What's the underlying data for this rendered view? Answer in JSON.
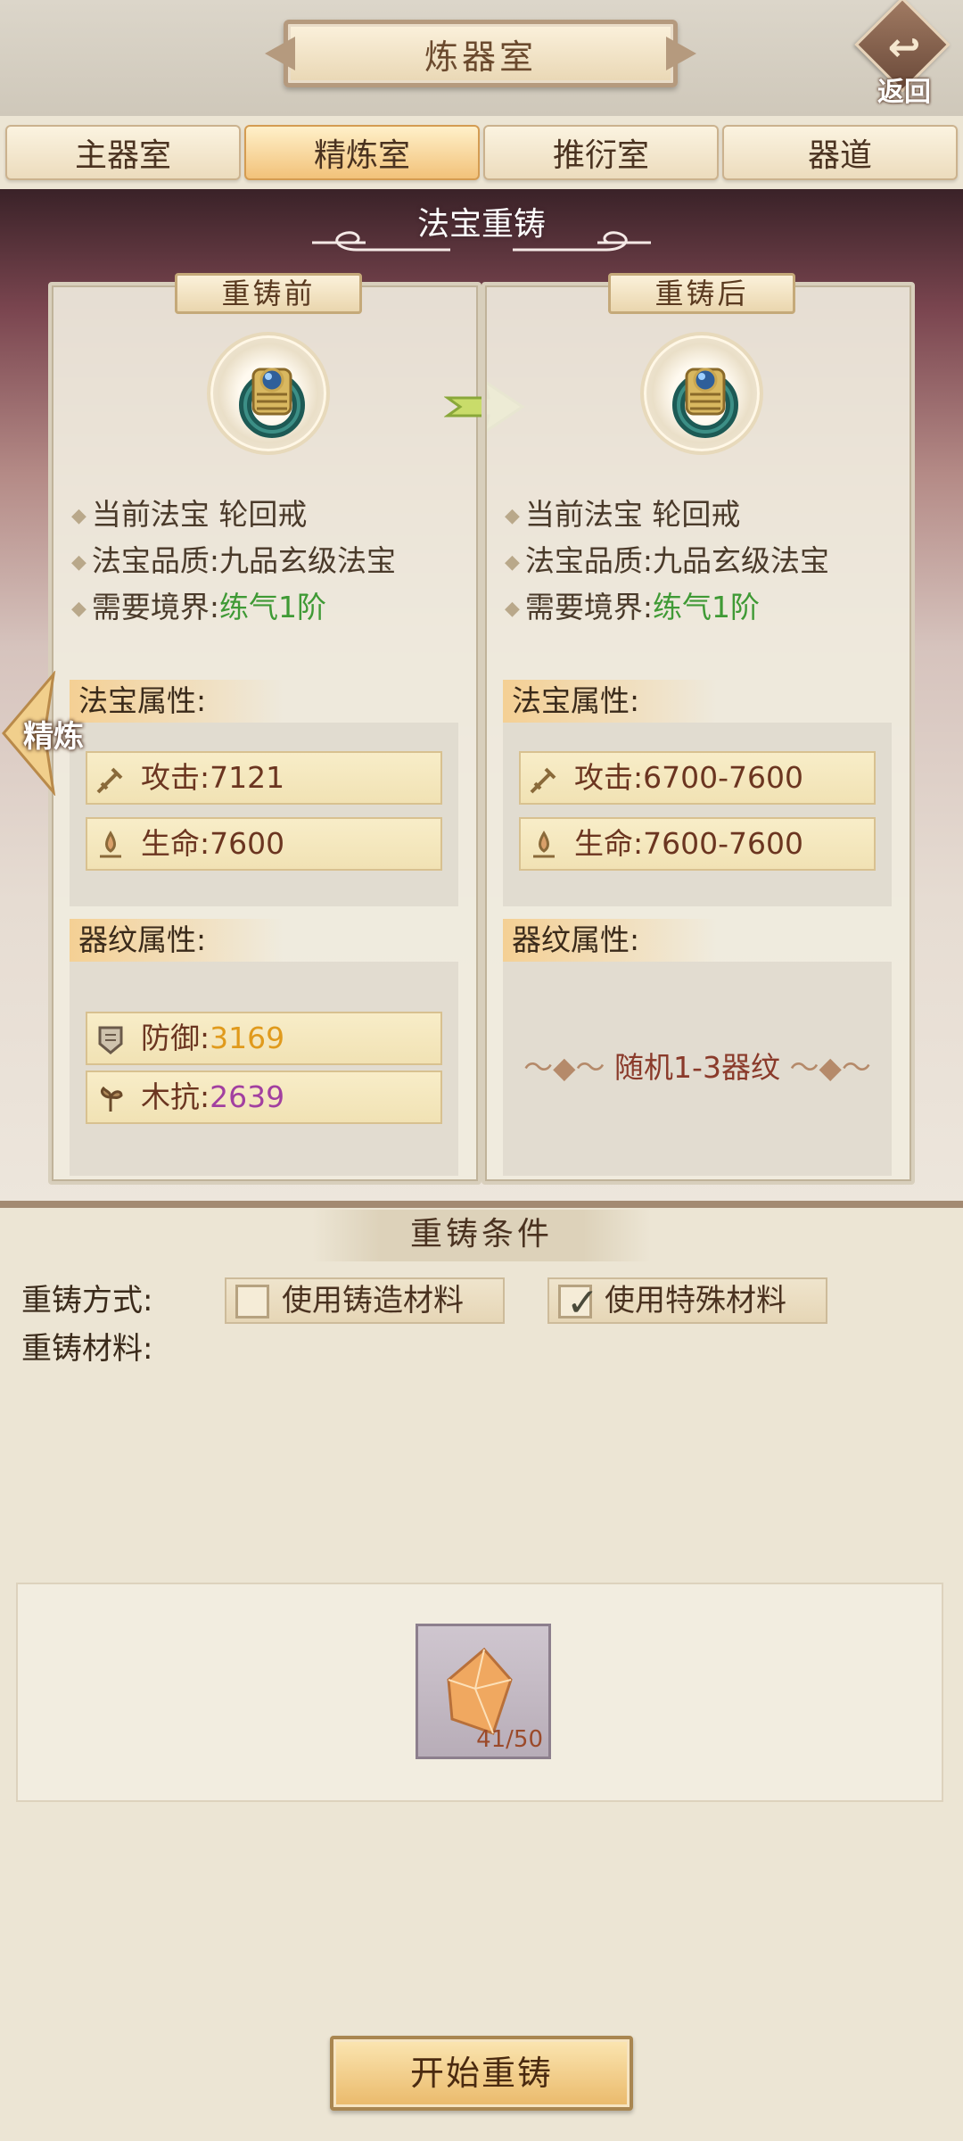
{
  "header": {
    "title": "炼器室",
    "back_label": "返回"
  },
  "tabs": [
    {
      "label": "主器室",
      "active": false
    },
    {
      "label": "精炼室",
      "active": true
    },
    {
      "label": "推衍室",
      "active": false
    },
    {
      "label": "器道",
      "active": false
    }
  ],
  "section_title": "法宝重铸",
  "side_tab": "精炼",
  "before": {
    "title": "重铸前",
    "item_icon": "ring-icon",
    "name_label": "当前法宝",
    "name_value": "轮回戒",
    "quality_label": "法宝品质:",
    "quality_value": "九品玄级法宝",
    "realm_label": "需要境界:",
    "realm_value": "练气1阶",
    "attr_title": "法宝属性:",
    "attack_label": "攻击:",
    "attack_value": "7121",
    "hp_label": "生命:",
    "hp_value": "7600",
    "pattern_title": "器纹属性:",
    "patterns": [
      {
        "icon": "defense-icon",
        "label": "防御:",
        "value": "3169"
      },
      {
        "icon": "wood-resist-icon",
        "label": "木抗:",
        "value": "2639"
      }
    ]
  },
  "after": {
    "title": "重铸后",
    "item_icon": "ring-icon",
    "name_label": "当前法宝",
    "name_value": "轮回戒",
    "quality_label": "法宝品质:",
    "quality_value": "九品玄级法宝",
    "realm_label": "需要境界:",
    "realm_value": "练气1阶",
    "attr_title": "法宝属性:",
    "attack_label": "攻击:",
    "attack_value": "6700-7600",
    "hp_label": "生命:",
    "hp_value": "7600-7600",
    "pattern_title": "器纹属性:",
    "random_pattern": "随机1-3器纹"
  },
  "conditions": {
    "title": "重铸条件",
    "method_label": "重铸方式:",
    "material_label": "重铸材料:",
    "option_normal": {
      "label": "使用铸造材料",
      "checked": false
    },
    "option_special": {
      "label": "使用特殊材料",
      "checked": true
    },
    "material": {
      "icon": "crystal-icon",
      "count": "41/50"
    }
  },
  "start_button": "开始重铸",
  "colors": {
    "green": "#3f9a35",
    "orange": "#e09a1c",
    "purple": "#a23fa0",
    "accent": "#eab96a"
  }
}
